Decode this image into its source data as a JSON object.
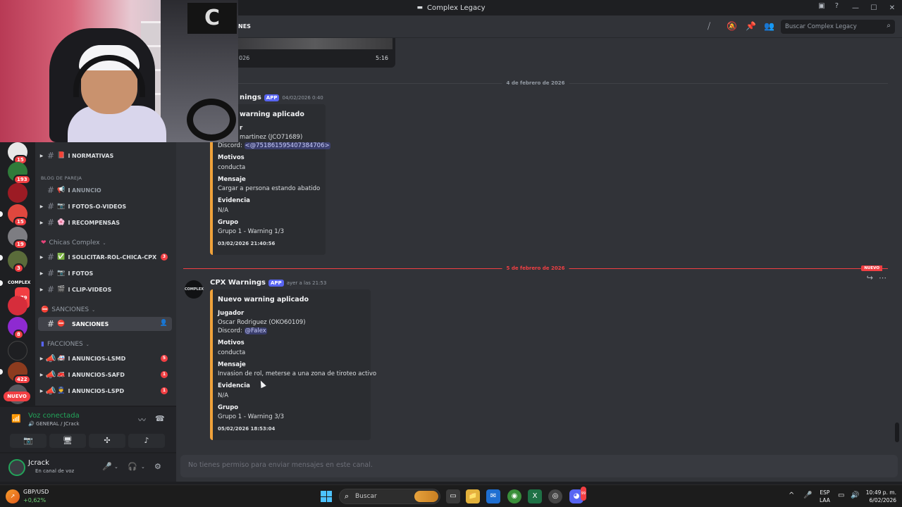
{
  "window": {
    "title": "Complex Legacy",
    "controls": [
      "—",
      "☐",
      "✕"
    ]
  },
  "rail": {
    "badges": [
      "15",
      "193",
      "15",
      "19",
      "3",
      "279",
      "8",
      "422"
    ],
    "nuevo": "NUEVO",
    "complex_label": "COMPLEX"
  },
  "channels": {
    "items": [
      {
        "label": "NORMATIVAS",
        "emoji": "📕"
      },
      {
        "label": "ANUNCIO",
        "emoji": "📢"
      },
      {
        "label": "FOTOS-O-VIDEOS",
        "emoji": "📷"
      },
      {
        "label": "RECOMPENSAS",
        "emoji": "🌸"
      },
      {
        "label": "SOLICITAR-ROL-CHICA-CPX",
        "emoji": "✅",
        "count": "3"
      },
      {
        "label": "FOTOS",
        "emoji": "📷"
      },
      {
        "label": "CLIP-VIDEOS",
        "emoji": "🎬"
      },
      {
        "label": "SANCIONES",
        "emoji": "⛔"
      },
      {
        "label": "ANUNCIOS-LSMD",
        "emoji": "🚑",
        "count": "5"
      },
      {
        "label": "ANUNCIOS-SAFD",
        "emoji": "🚒",
        "count": "1"
      },
      {
        "label": "ANUNCIOS-LSPD",
        "emoji": "👮",
        "count": "1"
      }
    ],
    "sep": "l",
    "categories": {
      "blog": "BLOG DE PAREJA",
      "chicas": "Chicas Complex",
      "sanciones": "SANCIONES",
      "facciones": "FACCIONES"
    }
  },
  "voice": {
    "title": "Voz conectada",
    "subtitle": "🔊 GENERAL / JCrack"
  },
  "user": {
    "name": "Jcrack",
    "status": "En canal de voz"
  },
  "header": {
    "channel_name": "NES",
    "search_placeholder": "Buscar Complex Legacy"
  },
  "video": {
    "left_text": "026",
    "duration": "5:16"
  },
  "dividers": {
    "d1": "4 de febrero de 2026",
    "d2": "5 de febrero de 2026",
    "new_tag": "NUEVO"
  },
  "msg1": {
    "author": "nings",
    "app_tag": "APP",
    "time": "04/02/2026 0:40",
    "title": "warning aplicado",
    "field1_name": "r",
    "field1_line1": "martinez (JCO71689)",
    "field1_line2_prefix": "Discord: ",
    "field1_mention": "<@751861595407384706>",
    "motivos_label": "Motivos",
    "motivos": "conducta",
    "mensaje_label": "Mensaje",
    "mensaje": "Cargar a persona estando abatido",
    "evidencia_label": "Evidencia",
    "evidencia": "N/A",
    "grupo_label": "Grupo",
    "grupo": "Grupo 1 - Warning 1/3",
    "footer": "03/02/2026 21:40:56"
  },
  "msg2": {
    "author": "CPX Warnings",
    "app_tag": "APP",
    "time": "ayer a las 21:53",
    "avatar_text": "COMPLEX",
    "title": "Nuevo warning aplicado",
    "jugador_label": "Jugador",
    "jugador": "Oscar Rodriguez (OKO60109)",
    "discord_prefix": "Discord: ",
    "discord_mention": "@Falex",
    "motivos_label": "Motivos",
    "motivos": "conducta",
    "mensaje_label": "Mensaje",
    "mensaje": "Invasion de rol, meterse a una zona de tiroteo activo",
    "evidencia_label": "Evidencia",
    "evidencia": "N/A",
    "grupo_label": "Grupo",
    "grupo": "Grupo 1 - Warning 3/3",
    "footer": "05/02/2026 18:53:04"
  },
  "composer": {
    "placeholder": "No tienes permiso para enviar mensajes en este canal."
  },
  "taskbar": {
    "widget_title": "GBP/USD",
    "widget_value": "+0,62%",
    "search": "Buscar",
    "lang1": "ESP",
    "lang2": "LAA",
    "time": "10:49 p. m.",
    "date": "6/02/2026",
    "discord_badge": "99"
  }
}
